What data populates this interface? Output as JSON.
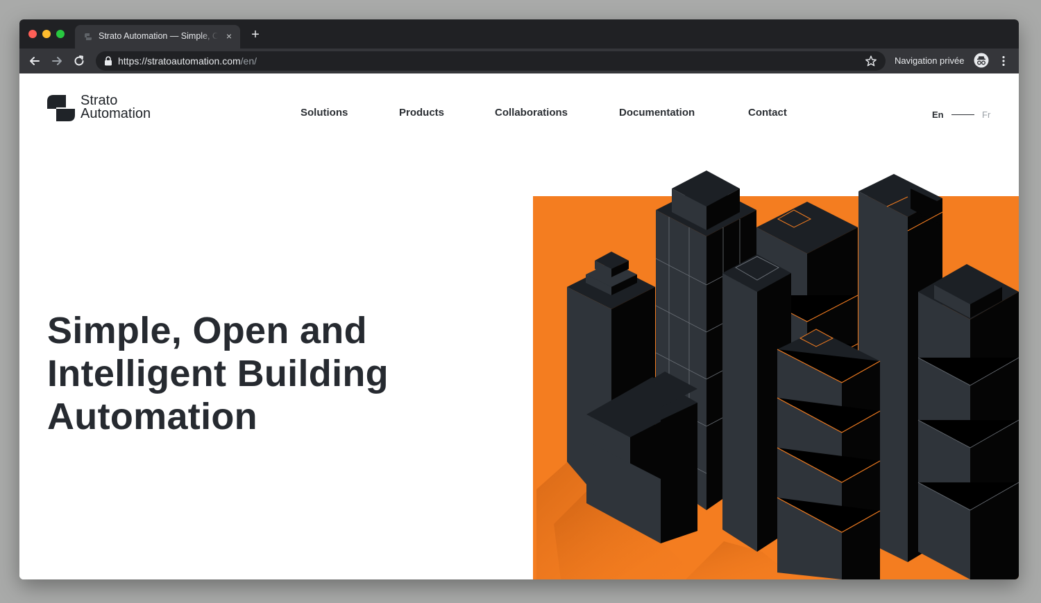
{
  "browser": {
    "tab_title": "Strato Automation — Simple, Open and Intelligent Building Automation",
    "tab_close": "×",
    "new_tab": "+",
    "url_host": "https://stratoautomation.com",
    "url_path": "/en/",
    "incognito_label": "Navigation privée"
  },
  "site": {
    "logo_line1": "Strato",
    "logo_line2": "Automation",
    "nav": [
      "Solutions",
      "Products",
      "Collaborations",
      "Documentation",
      "Contact"
    ],
    "lang_active": "En",
    "lang_inactive": "Fr",
    "hero_title": "Simple, Open and Intelligent Building Automation"
  },
  "colors": {
    "accent_orange": "#f47d20",
    "building_dark": "#2f343a",
    "building_black": "#050505",
    "chrome_dark": "#202124"
  }
}
